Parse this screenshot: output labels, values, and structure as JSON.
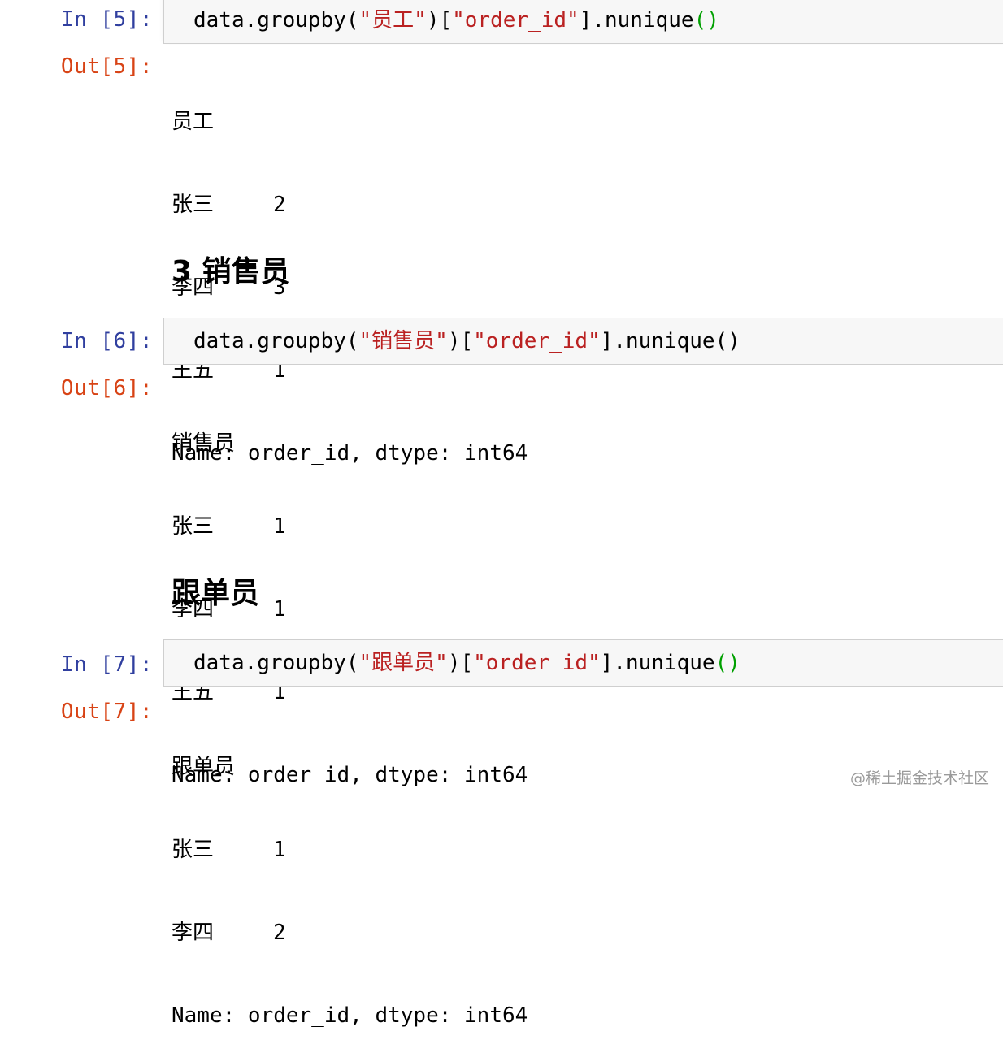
{
  "cells": [
    {
      "in_prompt": "In [5]:",
      "code": {
        "func": "data.groupby(",
        "arg1": "\"员工\"",
        "mid": ")[",
        "arg2": "\"order_id\"",
        "tail": "].nunique",
        "parens": "()"
      },
      "out_prompt": "Out[5]:",
      "output": {
        "header": "员工",
        "rows": [
          {
            "label": "张三",
            "value": "2"
          },
          {
            "label": "李四",
            "value": "3"
          },
          {
            "label": "王五",
            "value": "1"
          }
        ],
        "footer": "Name: order_id, dtype: int64"
      }
    },
    {
      "heading": "3 销售员",
      "in_prompt": "In [6]:",
      "code": {
        "func": "data.groupby(",
        "arg1": "\"销售员\"",
        "mid": ")[",
        "arg2": "\"order_id\"",
        "tail": "].nunique",
        "parens": "()"
      },
      "out_prompt": "Out[6]:",
      "output": {
        "header": "销售员",
        "rows": [
          {
            "label": "张三",
            "value": "1"
          },
          {
            "label": "李四",
            "value": "1"
          },
          {
            "label": "王五",
            "value": "1"
          }
        ],
        "footer": "Name: order_id, dtype: int64"
      }
    },
    {
      "heading": "跟单员",
      "in_prompt": "In [7]:",
      "code": {
        "func": "data.groupby(",
        "arg1": "\"跟单员\"",
        "mid": ")[",
        "arg2": "\"order_id\"",
        "tail": "].nunique",
        "parens": "()"
      },
      "out_prompt": "Out[7]:",
      "output": {
        "header": "跟单员",
        "rows": [
          {
            "label": "张三",
            "value": "1"
          },
          {
            "label": "李四",
            "value": "2"
          }
        ],
        "footer": "Name: order_id, dtype: int64"
      }
    }
  ],
  "watermark": "@稀土掘金技术社区",
  "colors": {
    "in_prompt": "#303f9f",
    "out_prompt": "#d84315",
    "string": "#ba2121",
    "bracket_match": "#00a000"
  }
}
